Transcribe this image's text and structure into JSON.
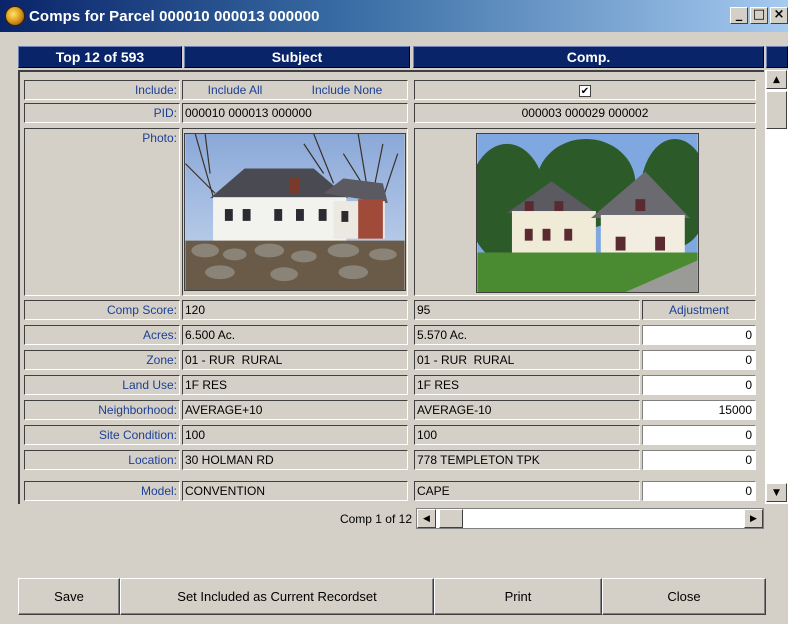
{
  "window": {
    "title": "Comps for Parcel 000010 000013 000000",
    "controls": {
      "minimize": "_",
      "maximize": "□",
      "close": "×"
    }
  },
  "header": {
    "position": "Top 12 of 593",
    "subject": "Subject",
    "comp": "Comp."
  },
  "labels": {
    "include": "Include:",
    "pid": "PID:",
    "photo": "Photo:",
    "comp_score": "Comp Score:",
    "acres": "Acres:",
    "zone": "Zone:",
    "land_use": "Land Use:",
    "neighborhood": "Neighborhood:",
    "site_condition": "Site Condition:",
    "location": "Location:",
    "model": "Model:"
  },
  "subject": {
    "include_all": "Include All",
    "include_none": "Include None",
    "pid": "000010 000013 000000",
    "comp_score": "120",
    "acres": "6.500 Ac.",
    "zone": "01 - RUR  RURAL",
    "land_use": "1F RES",
    "neighborhood": "AVERAGE+10",
    "site_condition": "100",
    "location": "30 HOLMAN RD",
    "model": "CONVENTION"
  },
  "comp": {
    "include_checked": "✔",
    "pid": "000003 000029 000002",
    "comp_score": "95",
    "adjustment_header": "Adjustment",
    "acres": "5.570 Ac.",
    "acres_adj": "0",
    "zone": "01 - RUR  RURAL",
    "zone_adj": "0",
    "land_use": "1F RES",
    "land_use_adj": "0",
    "neighborhood": "AVERAGE-10",
    "neighborhood_adj": "15000",
    "site_condition": "100",
    "site_condition_adj": "0",
    "location": "778 TEMPLETON TPK",
    "location_adj": "0",
    "model": "CAPE",
    "model_adj": "0"
  },
  "navigation": {
    "comp_position": "Comp 1 of 12"
  },
  "buttons": {
    "save": "Save",
    "set_included": "Set Included as Current Recordset",
    "print": "Print",
    "close": "Close"
  },
  "colors": {
    "header_bg": "#0a246a",
    "label_text": "#1c3f94",
    "face": "#d4d0c8"
  }
}
